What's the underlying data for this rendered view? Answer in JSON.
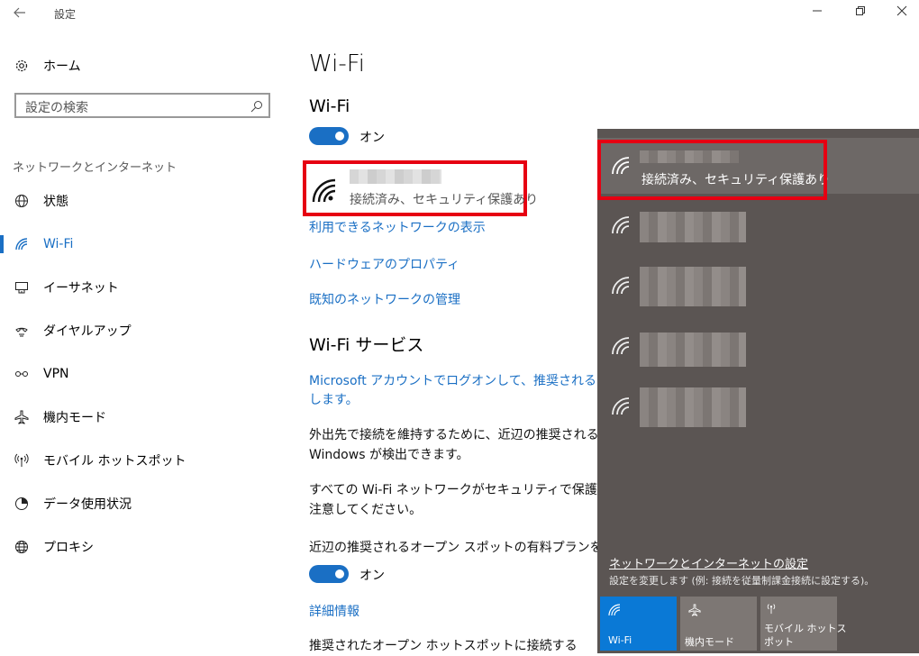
{
  "titlebar": {
    "back_icon": "back-arrow-icon",
    "title": "設定",
    "minimize": "—",
    "restore": "❐",
    "close": "✕"
  },
  "sidebar": {
    "home_label": "ホーム",
    "search_placeholder": "設定の検索",
    "section_title": "ネットワークとインターネット",
    "items": [
      {
        "label": "状態",
        "icon": "globe-status-icon"
      },
      {
        "label": "Wi-Fi",
        "icon": "wifi-icon"
      },
      {
        "label": "イーサネット",
        "icon": "ethernet-icon"
      },
      {
        "label": "ダイヤルアップ",
        "icon": "dialup-icon"
      },
      {
        "label": "VPN",
        "icon": "vpn-icon"
      },
      {
        "label": "機内モード",
        "icon": "airplane-icon"
      },
      {
        "label": "モバイル ホットスポット",
        "icon": "hotspot-icon"
      },
      {
        "label": "データ使用状況",
        "icon": "data-usage-icon"
      },
      {
        "label": "プロキシ",
        "icon": "globe-icon"
      }
    ]
  },
  "main": {
    "page_title": "Wi-Fi",
    "wifi_heading": "Wi-Fi",
    "wifi_toggle_label": "オン",
    "network_status": "接続済み、セキュリティ保護あり",
    "links": {
      "show_networks": "利用できるネットワークの表示",
      "hardware_props": "ハードウェアのプロパティ",
      "manage_known": "既知のネットワークの管理"
    },
    "services_heading": "Wi-Fi サービス",
    "ms_account_link_1": "Microsoft アカウントでログオンして、推奨されるオープン",
    "ms_account_link_2": "します。",
    "para1_line1": "外出先で接続を維持するために、近辺の推奨されるオ",
    "para1_line2": "Windows が検出できます。",
    "para2_line1": "すべての Wi-Fi ネットワークがセキュリティで保護されてい",
    "para2_line2": "注意してください。",
    "paid_plans_label": "近辺の推奨されるオープン スポットの有料プランを探す",
    "paid_toggle_label": "オン",
    "details_link": "詳細情報",
    "connect_suggested": "推奨されたオープン ホットスポットに接続する"
  },
  "flyout": {
    "connected_status": "接続済み、セキュリティ保護あり",
    "settings_link": "ネットワークとインターネットの設定",
    "settings_desc": "設定を変更します (例: 接続を従量制課金接続に設定する)。",
    "tiles": [
      {
        "label": "Wi-Fi",
        "icon": "wifi-icon",
        "active": true
      },
      {
        "label": "機内モード",
        "icon": "airplane-icon",
        "active": false
      },
      {
        "label_line1": "モバイル ホットス",
        "label_line2": "ポット",
        "icon": "hotspot-icon",
        "active": false
      }
    ]
  },
  "colors": {
    "accent": "#1a6fc4",
    "highlight": "#e60012",
    "flyout_bg": "#5b5553",
    "tile_active": "#0a79d6"
  }
}
